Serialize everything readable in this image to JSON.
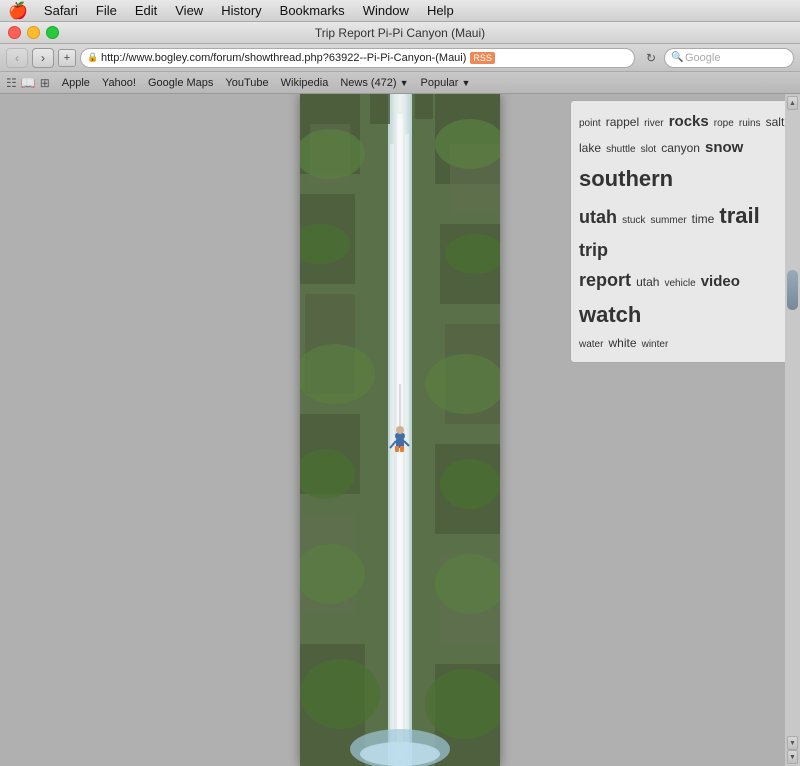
{
  "menubar": {
    "apple": "🍎",
    "items": [
      "Safari",
      "File",
      "Edit",
      "View",
      "History",
      "Bookmarks",
      "Window",
      "Help"
    ]
  },
  "titlebar": {
    "title": "Trip Report Pi-Pi Canyon (Maui)"
  },
  "toolbar": {
    "back_label": "‹",
    "forward_label": "›",
    "plus_label": "+",
    "address": "http://www.bogley.com/forum/showthread.php?63922--Pi-Pi-Canyon-(Maui)",
    "rss": "RSS",
    "refresh": "↻",
    "search_placeholder": "Google"
  },
  "bookmarks": {
    "icon1": "☷",
    "icon2": "📖",
    "icon3": "⊞",
    "items": [
      "Apple",
      "Yahoo!",
      "Google Maps",
      "YouTube",
      "Wikipedia"
    ],
    "news_label": "News (472)",
    "popular_label": "Popular"
  },
  "tag_cloud": {
    "tags": [
      {
        "text": "point",
        "size": "sm"
      },
      {
        "text": "rappel",
        "size": "md"
      },
      {
        "text": "river",
        "size": "sm"
      },
      {
        "text": "rocks",
        "size": "lg"
      },
      {
        "text": "rope",
        "size": "sm"
      },
      {
        "text": "ruins",
        "size": "sm"
      },
      {
        "text": "salt",
        "size": "md"
      },
      {
        "text": "lake",
        "size": "md"
      },
      {
        "text": "shuttle",
        "size": "sm"
      },
      {
        "text": "slot",
        "size": "sm"
      },
      {
        "text": "canyon",
        "size": "md"
      },
      {
        "text": "snow",
        "size": "lg"
      },
      {
        "text": "southern",
        "size": "xxl"
      },
      {
        "text": "utah",
        "size": "xl"
      },
      {
        "text": "stuck",
        "size": "sm"
      },
      {
        "text": "summer",
        "size": "sm"
      },
      {
        "text": "time",
        "size": "md"
      },
      {
        "text": "trail",
        "size": "xxl"
      },
      {
        "text": "trip",
        "size": "xl"
      },
      {
        "text": "report",
        "size": "xl"
      },
      {
        "text": "utah",
        "size": "md"
      },
      {
        "text": "vehicle",
        "size": "sm"
      },
      {
        "text": "video",
        "size": "lg"
      },
      {
        "text": "watch",
        "size": "xxl"
      },
      {
        "text": "water",
        "size": "sm"
      },
      {
        "text": "white",
        "size": "md"
      },
      {
        "text": "winter",
        "size": "sm"
      }
    ]
  }
}
